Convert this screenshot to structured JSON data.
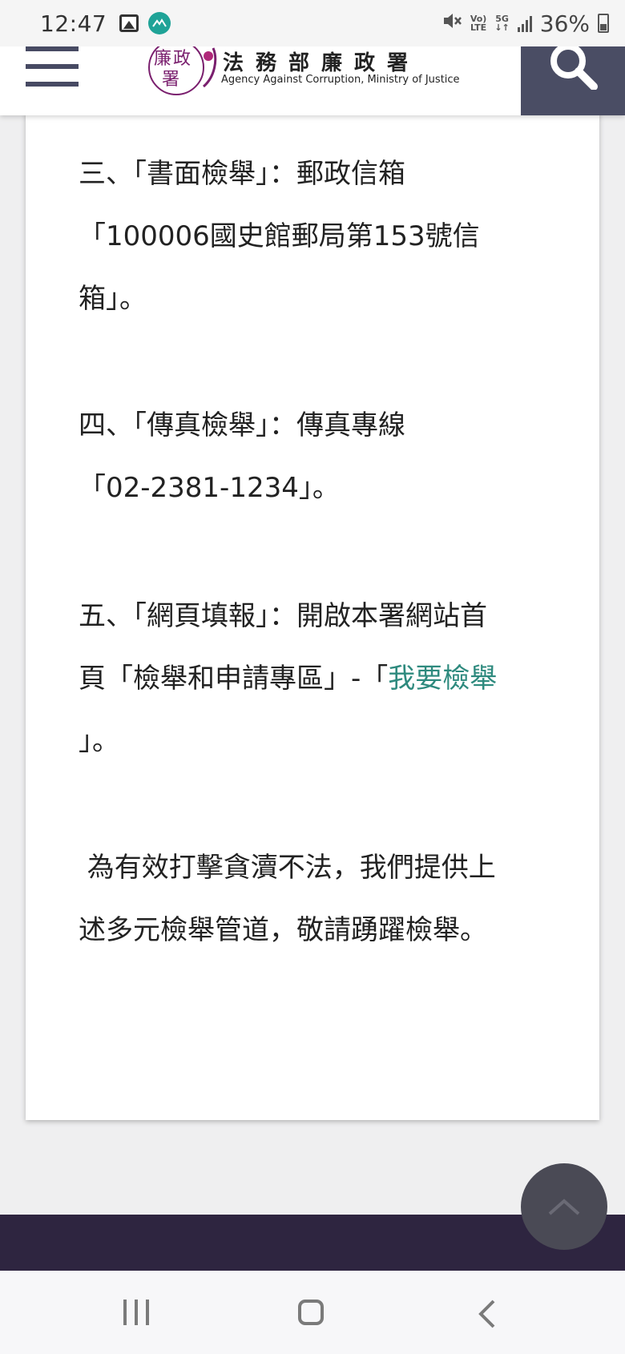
{
  "status_bar": {
    "time": "12:47",
    "icons": [
      "gallery-icon",
      "app-notification-icon",
      "mute-icon",
      "volte-icon",
      "5g-icon",
      "signal-icon",
      "battery-icon"
    ],
    "volte_top": "Vo)",
    "volte_bottom": "LTE",
    "network_top": "5G",
    "network_bottom": "↓↑",
    "battery": "36%"
  },
  "header": {
    "logo_text": "廉政署",
    "agency_name_zh": "法務部廉政署",
    "agency_name_en": "Agency Against Corruption, Ministry of Justice",
    "colors": {
      "brand_purple": "#7a1f6e",
      "menu": "#474a63",
      "search_bg": "#4a4d64"
    }
  },
  "content": {
    "item3": {
      "lines": [
        "三、「書面檢舉」：郵政信箱",
        "「100006國史館郵局第153號信",
        "箱」。"
      ]
    },
    "item4": {
      "lines": [
        "四、「傳真檢舉」：傳真專線",
        "「02-2381-1234」。"
      ]
    },
    "item5": {
      "line1": "五、「網頁填報」：開啟本署網站首",
      "line2_prefix": "頁「檢舉和申請專區」-「",
      "link": "我要檢舉",
      "line3": "」。",
      "link_color": "#2e8a7e"
    },
    "closing": {
      "lines": [
        " 為有效打擊貪瀆不法，我們提供上",
        "述多元檢舉管道，敬請踴躍檢舉。"
      ]
    }
  },
  "footer": {
    "color": "#2e2540"
  }
}
